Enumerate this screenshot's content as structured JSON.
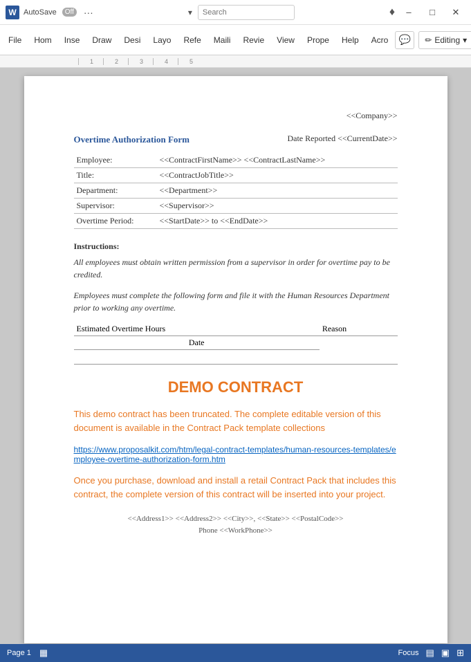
{
  "titlebar": {
    "app_icon": "W",
    "autosave_label": "AutoSave",
    "toggle_label": "Off",
    "more_label": "···",
    "minimize_label": "–",
    "maximize_label": "□",
    "close_label": "✕"
  },
  "ribbon": {
    "tabs": [
      {
        "label": "File",
        "active": false
      },
      {
        "label": "Hom",
        "active": false
      },
      {
        "label": "Inse",
        "active": false
      },
      {
        "label": "Draw",
        "active": false
      },
      {
        "label": "Desi",
        "active": false
      },
      {
        "label": "Layo",
        "active": false
      },
      {
        "label": "Refe",
        "active": false
      },
      {
        "label": "Maili",
        "active": false
      },
      {
        "label": "Revie",
        "active": false
      },
      {
        "label": "View",
        "active": false
      },
      {
        "label": "Prope",
        "active": false
      },
      {
        "label": "Help",
        "active": false
      },
      {
        "label": "Acro",
        "active": false
      }
    ],
    "comment_icon": "💬",
    "editing_label": "Editing",
    "editing_icon": "✏"
  },
  "document": {
    "company": "<<Company>>",
    "form_title": "Overtime Authorization Form",
    "date_reported_label": "Date Reported <<CurrentDate>>",
    "fields": [
      {
        "label": "Employee:",
        "value": "<<ContractFirstName>> <<ContractLastName>>"
      },
      {
        "label": "Title:",
        "value": "<<ContractJobTitle>>"
      },
      {
        "label": "Department:",
        "value": "<<Department>>"
      },
      {
        "label": "Supervisor:",
        "value": "<<Supervisor>>"
      },
      {
        "label": "Overtime Period:",
        "value": "<<StartDate>> to <<EndDate>>"
      }
    ],
    "instructions_label": "Instructions:",
    "instructions_p1": "All employees must obtain written permission from a supervisor in order for overtime pay to be credited.",
    "instructions_p2": "Employees must complete the following form and file it with the Human Resources Department prior to working any overtime.",
    "hours_col1": "Estimated Overtime Hours",
    "hours_col2": "Reason",
    "hours_col3": "Date",
    "demo_title": "DEMO CONTRACT",
    "demo_text1": "This demo contract has been truncated. The complete editable version of this document is available in the Contract Pack template collections",
    "demo_link": "https://www.proposalkit.com/htm/legal-contract-templates/human-resources-templates/employee-overtime-authorization-form.htm",
    "demo_text2": "Once you purchase, download and install a retail Contract Pack that includes this contract, the complete version of this contract will be inserted into your project.",
    "footer_line1": "<<Address1>> <<Address2>> <<City>>, <<State>> <<PostalCode>>",
    "footer_line2": "Phone <<WorkPhone>>"
  },
  "statusbar": {
    "page_label": "Page 1",
    "focus_label": "Focus",
    "icons": [
      "📄",
      "🔍",
      "▦",
      "📋"
    ]
  }
}
